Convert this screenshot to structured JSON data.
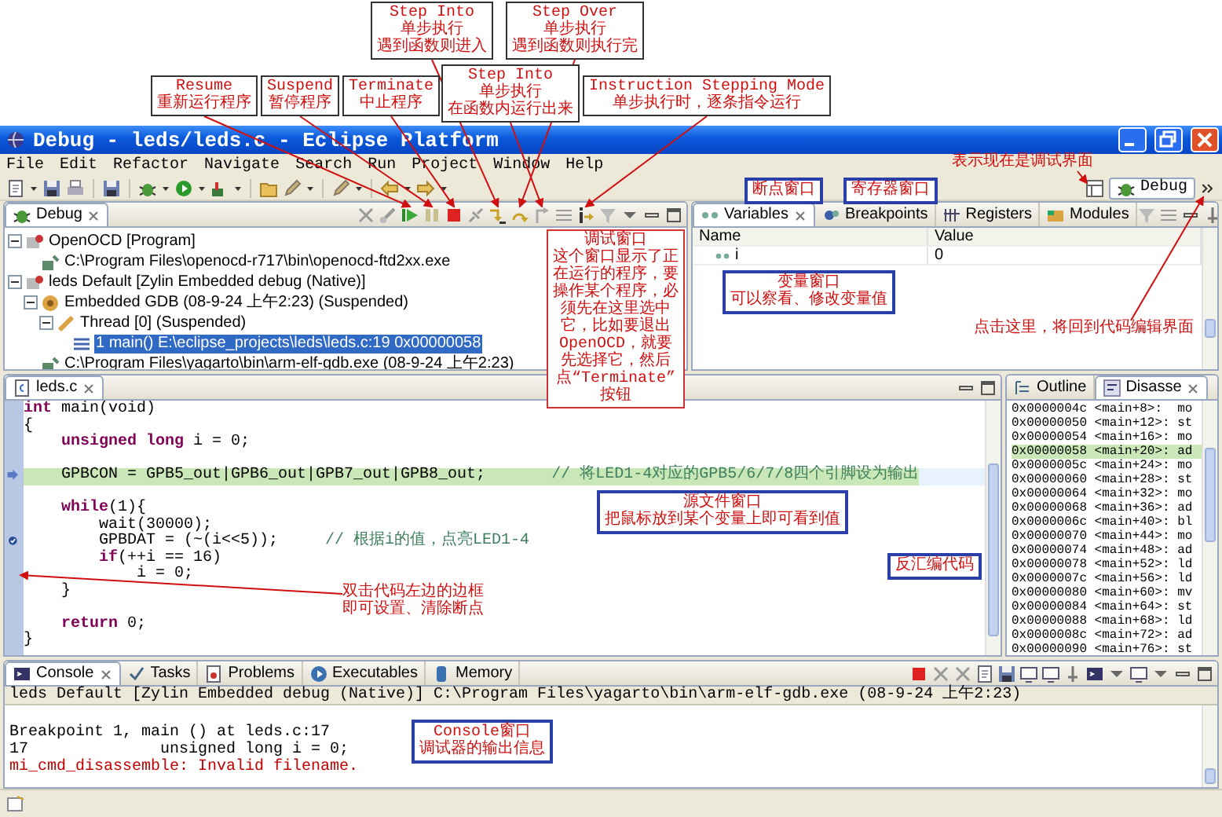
{
  "window": {
    "title": "Debug - leds/leds.c - Eclipse Platform"
  },
  "menu": [
    "File",
    "Edit",
    "Refactor",
    "Navigate",
    "Search",
    "Run",
    "Project",
    "Window",
    "Help"
  ],
  "perspective": {
    "label": "Debug",
    "selected": true
  },
  "debug_view": {
    "tab": "Debug",
    "tree": [
      {
        "label": "OpenOCD [Program]",
        "kind": "launch",
        "expanded": true,
        "selected": false,
        "children": [
          {
            "label": "C:\\Program Files\\openocd-r717\\bin\\openocd-ftd2xx.exe",
            "kind": "process",
            "selected": false
          }
        ]
      },
      {
        "label": "leds Default [Zylin Embedded debug (Native)]",
        "kind": "launch",
        "expanded": true,
        "selected": false,
        "children": [
          {
            "label": "Embedded GDB (08-9-24 上午2:23) (Suspended)",
            "kind": "target",
            "expanded": true,
            "selected": false,
            "children": [
              {
                "label": "Thread [0] (Suspended)",
                "kind": "thread",
                "expanded": true,
                "selected": false,
                "children": [
                  {
                    "label": "1 main() E:\\eclipse_projects\\leds\\leds.c:19 0x00000058",
                    "kind": "frame",
                    "selected": true
                  }
                ]
              }
            ]
          },
          {
            "label": "C:\\Program Files\\yagarto\\bin\\arm-elf-gdb.exe (08-9-24 上午2:23)",
            "kind": "process",
            "selected": false
          }
        ]
      }
    ]
  },
  "variables_view": {
    "tabs": [
      {
        "label": "Variables",
        "selected": true
      },
      {
        "label": "Breakpoints",
        "selected": false
      },
      {
        "label": "Registers",
        "selected": false
      },
      {
        "label": "Modules",
        "selected": false
      }
    ],
    "columns": [
      "Name",
      "Value"
    ],
    "rows": [
      {
        "name": "i",
        "value": "0"
      }
    ]
  },
  "editor": {
    "tab": "leds.c",
    "lines": [
      {
        "kind": "code",
        "current": false,
        "tokens": [
          {
            "kind": "keyword",
            "text": "int"
          },
          {
            "kind": "plain",
            "text": " main(void)"
          }
        ]
      },
      {
        "kind": "code",
        "current": false,
        "tokens": [
          {
            "kind": "plain",
            "text": "{"
          }
        ]
      },
      {
        "kind": "code",
        "current": false,
        "tokens": [
          {
            "kind": "keyword",
            "text": "    unsigned long"
          },
          {
            "kind": "plain",
            "text": " i = 0;"
          }
        ]
      },
      {
        "kind": "code",
        "current": false
      },
      {
        "kind": "pointer",
        "current": true,
        "tokens": [
          {
            "kind": "plain",
            "text": "    GPBCON = GPB5_out|GPB6_out|GPB7_out|GPB8_out;       "
          },
          {
            "kind": "comment",
            "text": "// 将LED1-4对应的GPB5/6/7/8四个引脚设为输出"
          }
        ]
      },
      {
        "kind": "code",
        "current": false
      },
      {
        "kind": "code",
        "current": false,
        "tokens": [
          {
            "kind": "keyword",
            "text": "    while"
          },
          {
            "kind": "plain",
            "text": "(1){"
          }
        ]
      },
      {
        "kind": "code",
        "current": false,
        "tokens": [
          {
            "kind": "plain",
            "text": "        wait(30000);"
          }
        ]
      },
      {
        "kind": "breakpoint",
        "current": false,
        "tokens": [
          {
            "kind": "plain",
            "text": "        GPBDAT = (~(i<<5));     "
          },
          {
            "kind": "comment",
            "text": "// 根据i的值，点亮LED1-4"
          }
        ]
      },
      {
        "kind": "code",
        "current": false,
        "tokens": [
          {
            "kind": "keyword",
            "text": "        if"
          },
          {
            "kind": "plain",
            "text": "(++i == 16)"
          }
        ]
      },
      {
        "kind": "code",
        "current": false,
        "tokens": [
          {
            "kind": "plain",
            "text": "            i = 0;"
          }
        ]
      },
      {
        "kind": "code",
        "current": false,
        "tokens": [
          {
            "kind": "plain",
            "text": "    }"
          }
        ]
      },
      {
        "kind": "code",
        "current": false
      },
      {
        "kind": "code",
        "current": false,
        "tokens": [
          {
            "kind": "keyword",
            "text": "    return"
          },
          {
            "kind": "plain",
            "text": " 0;"
          }
        ]
      },
      {
        "kind": "code",
        "current": false,
        "tokens": [
          {
            "kind": "plain",
            "text": "}"
          }
        ]
      }
    ]
  },
  "disassembly_view": {
    "tabs": [
      {
        "label": "Outline",
        "selected": false
      },
      {
        "label": "Disasse",
        "selected": true
      }
    ],
    "lines": [
      {
        "text": "0x0000004c <main+8>:  mo",
        "selected": false
      },
      {
        "text": "0x00000050 <main+12>: st",
        "selected": false
      },
      {
        "text": "0x00000054 <main+16>: mo",
        "selected": false
      },
      {
        "text": "0x00000058 <main+20>: ad",
        "selected": true
      },
      {
        "text": "0x0000005c <main+24>: mo",
        "selected": false
      },
      {
        "text": "0x00000060 <main+28>: st",
        "selected": false
      },
      {
        "text": "0x00000064 <main+32>: mo",
        "selected": false
      },
      {
        "text": "0x00000068 <main+36>: ad",
        "selected": false
      },
      {
        "text": "0x0000006c <main+40>: bl",
        "selected": false
      },
      {
        "text": "0x00000070 <main+44>: mo",
        "selected": false
      },
      {
        "text": "0x00000074 <main+48>: ad",
        "selected": false
      },
      {
        "text": "0x00000078 <main+52>: ld",
        "selected": false
      },
      {
        "text": "0x0000007c <main+56>: ld",
        "selected": false
      },
      {
        "text": "0x00000080 <main+60>: mv",
        "selected": false
      },
      {
        "text": "0x00000084 <main+64>: st",
        "selected": false
      },
      {
        "text": "0x00000088 <main+68>: ld",
        "selected": false
      },
      {
        "text": "0x0000008c <main+72>: ad",
        "selected": false
      },
      {
        "text": "0x00000090 <main+76>: st",
        "selected": false
      }
    ]
  },
  "console_view": {
    "tabs": [
      {
        "label": "Console",
        "selected": true
      },
      {
        "label": "Tasks",
        "selected": false
      },
      {
        "label": "Problems",
        "selected": false
      },
      {
        "label": "Executables",
        "selected": false
      },
      {
        "label": "Memory",
        "selected": false
      }
    ],
    "header": "leds Default [Zylin Embedded debug (Native)] C:\\Program Files\\yagarto\\bin\\arm-elf-gdb.exe (08-9-24 上午2:23)",
    "lines": [
      {
        "text": "Breakpoint 1, main () at leds.c:17",
        "kind": "output"
      },
      {
        "text": "17              unsigned long i = 0;",
        "kind": "output"
      },
      {
        "text": "mi_cmd_disassemble: Invalid filename.",
        "kind": "error"
      }
    ]
  },
  "annotations": [
    {
      "kind": "dark",
      "lines": [
        "Step Into",
        "单步执行",
        "遇到函数则进入"
      ]
    },
    {
      "kind": "dark",
      "lines": [
        "Step Over",
        "单步执行",
        "遇到函数则执行完"
      ]
    },
    {
      "kind": "dark",
      "lines": [
        "Resume",
        "重新运行程序"
      ]
    },
    {
      "kind": "dark",
      "lines": [
        "Suspend",
        "暂停程序"
      ]
    },
    {
      "kind": "dark",
      "lines": [
        "Terminate",
        "中止程序"
      ]
    },
    {
      "kind": "dark",
      "lines": [
        "Step Into",
        "单步执行",
        "在函数内运行出来"
      ]
    },
    {
      "kind": "dark",
      "lines": [
        "Instruction Stepping Mode",
        "单步执行时，逐条指令运行"
      ]
    },
    {
      "kind": "plain",
      "lines": [
        "表示现在是调试界面"
      ]
    },
    {
      "kind": "blue",
      "lines": [
        "断点窗口"
      ]
    },
    {
      "kind": "blue",
      "lines": [
        "寄存器窗口"
      ]
    },
    {
      "kind": "red",
      "lines": [
        "调试窗口",
        "这个窗口显示了正在运行的程序，要操作某个程序，必须先在这里选中它，比如要退出OpenOCD，就要先选择它，然后点“Terminate”按钮"
      ]
    },
    {
      "kind": "blue",
      "lines": [
        "变量窗口",
        "可以察看、修改变量值"
      ]
    },
    {
      "kind": "plain",
      "lines": [
        "点击这里，将回到代码编辑界面"
      ]
    },
    {
      "kind": "blue",
      "lines": [
        "源文件窗口",
        "把鼠标放到某个变量上即可看到值"
      ]
    },
    {
      "kind": "blue",
      "lines": [
        "反汇编代码"
      ]
    },
    {
      "kind": "plain",
      "lines": [
        "双击代码左边的边框",
        "即可设置、清除断点"
      ]
    },
    {
      "kind": "blue",
      "lines": [
        "Console窗口",
        "调试器的输出信息"
      ]
    }
  ]
}
